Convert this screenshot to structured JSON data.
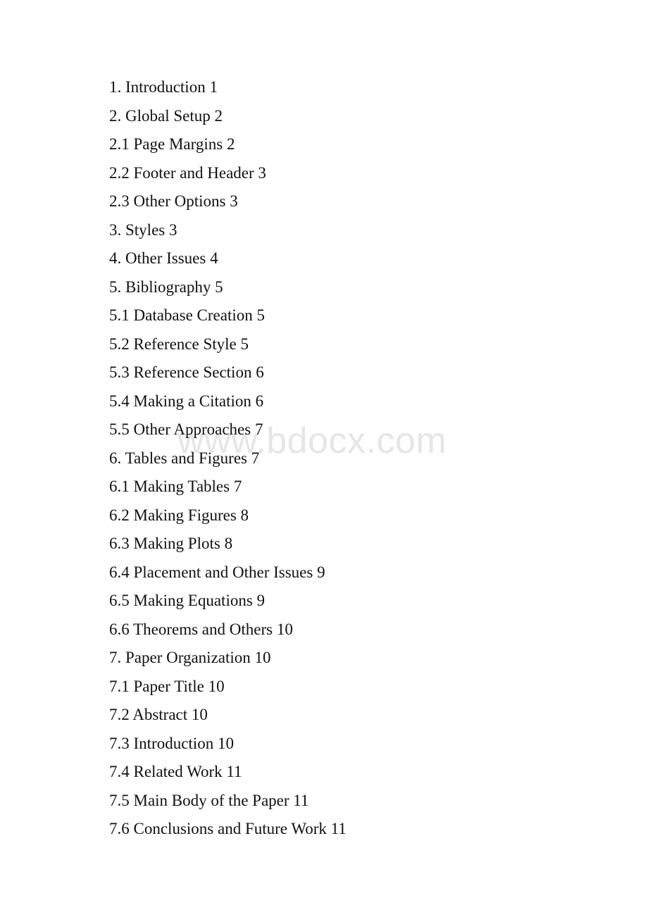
{
  "document": {
    "type": "table-of-contents",
    "background_color": "#ffffff",
    "text_color": "#111111"
  },
  "watermark": {
    "text": "www.bdocx.com",
    "color": "#e6e6e6"
  },
  "toc": {
    "entries": [
      {
        "number": "1.",
        "title": "Introduction",
        "page": "1",
        "full": "1. Introduction 1"
      },
      {
        "number": "2.",
        "title": "Global Setup",
        "page": "2",
        "full": "2. Global Setup 2"
      },
      {
        "number": "2.1",
        "title": "Page Margins",
        "page": "2",
        "full": "2.1 Page Margins 2"
      },
      {
        "number": "2.2",
        "title": "Footer and Header",
        "page": "3",
        "full": "2.2 Footer and Header 3"
      },
      {
        "number": "2.3",
        "title": "Other Options",
        "page": "3",
        "full": "2.3 Other Options 3"
      },
      {
        "number": "3.",
        "title": "Styles",
        "page": "3",
        "full": "3. Styles 3"
      },
      {
        "number": "4.",
        "title": "Other Issues",
        "page": "4",
        "full": "4. Other Issues 4"
      },
      {
        "number": "5.",
        "title": "Bibliography",
        "page": "5",
        "full": "5. Bibliography 5"
      },
      {
        "number": "5.1",
        "title": "Database Creation",
        "page": "5",
        "full": "5.1 Database Creation 5"
      },
      {
        "number": "5.2",
        "title": "Reference Style",
        "page": "5",
        "full": "5.2 Reference Style 5"
      },
      {
        "number": "5.3",
        "title": "Reference Section",
        "page": "6",
        "full": "5.3 Reference Section 6"
      },
      {
        "number": "5.4",
        "title": "Making a Citation",
        "page": "6",
        "full": "5.4 Making a Citation 6"
      },
      {
        "number": "5.5",
        "title": "Other Approaches",
        "page": "7",
        "full": "5.5 Other Approaches 7"
      },
      {
        "number": "6.",
        "title": "Tables and Figures",
        "page": "7",
        "full": "6. Tables and Figures 7"
      },
      {
        "number": "6.1",
        "title": "Making Tables",
        "page": "7",
        "full": "6.1 Making Tables 7"
      },
      {
        "number": "6.2",
        "title": "Making Figures",
        "page": "8",
        "full": "6.2 Making Figures 8"
      },
      {
        "number": "6.3",
        "title": "Making Plots",
        "page": "8",
        "full": "6.3 Making Plots 8"
      },
      {
        "number": "6.4",
        "title": "Placement and Other Issues",
        "page": "9",
        "full": "6.4 Placement and Other Issues 9"
      },
      {
        "number": "6.5",
        "title": "Making Equations",
        "page": "9",
        "full": "6.5 Making Equations 9"
      },
      {
        "number": "6.6",
        "title": "Theorems and Others",
        "page": "10",
        "full": "6.6 Theorems and Others 10"
      },
      {
        "number": "7.",
        "title": "Paper Organization",
        "page": "10",
        "full": "7. Paper Organization 10"
      },
      {
        "number": "7.1",
        "title": "Paper Title",
        "page": "10",
        "full": "7.1 Paper Title 10"
      },
      {
        "number": "7.2",
        "title": "Abstract",
        "page": "10",
        "full": "7.2 Abstract 10"
      },
      {
        "number": "7.3",
        "title": "Introduction",
        "page": "10",
        "full": "7.3 Introduction 10"
      },
      {
        "number": "7.4",
        "title": "Related Work",
        "page": "11",
        "full": "7.4 Related Work 11"
      },
      {
        "number": "7.5",
        "title": "Main Body of the Paper",
        "page": "11",
        "full": "7.5 Main Body of the Paper 11"
      },
      {
        "number": "7.6",
        "title": "Conclusions and Future Work",
        "page": "11",
        "full": "7.6 Conclusions and Future Work 11"
      }
    ]
  }
}
